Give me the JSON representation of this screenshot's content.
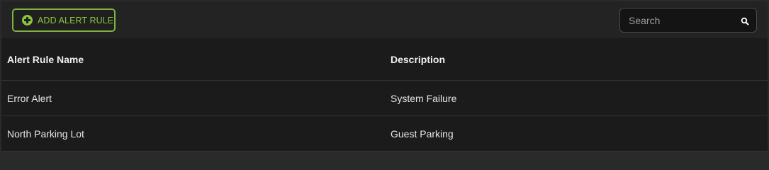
{
  "toolbar": {
    "add_button_label": "ADD ALERT RULE",
    "add_button_icon": "plus-circle-icon",
    "accent_color": "#8cc63f",
    "search": {
      "placeholder": "Search",
      "value": "",
      "icon": "search-icon"
    }
  },
  "table": {
    "columns": [
      "Alert Rule Name",
      "Description"
    ],
    "rows": [
      {
        "name": "Error Alert",
        "description": "System Failure"
      },
      {
        "name": "North Parking Lot",
        "description": "Guest Parking"
      }
    ]
  }
}
